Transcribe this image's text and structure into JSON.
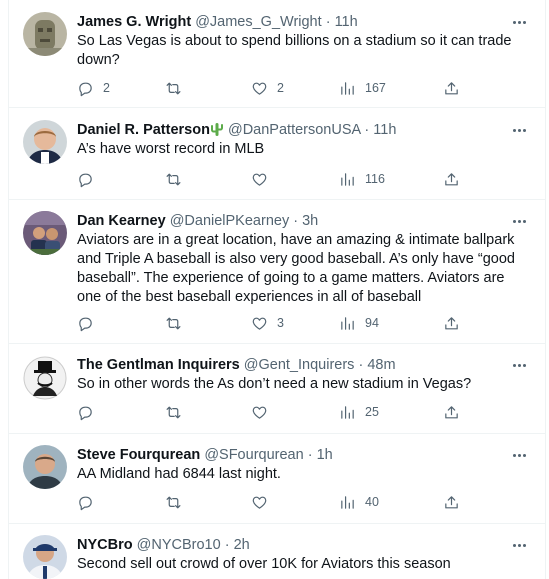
{
  "tweets": [
    {
      "name": "James G. Wright",
      "handle": "@James_G_Wright",
      "time": "11h",
      "text": "So Las Vegas is about to spend billions on a stadium so it can trade down?",
      "replies": "2",
      "retweets": "",
      "likes": "2",
      "views": "167"
    },
    {
      "name": "Daniel R. Patterson",
      "handle": "@DanPattersonUSA",
      "time": "11h",
      "text": "A’s have worst record in MLB",
      "replies": "",
      "retweets": "",
      "likes": "",
      "views": "116"
    },
    {
      "name": "Dan Kearney",
      "handle": "@DanielPKearney",
      "time": "3h",
      "text": "Aviators are in a great location, have an amazing & intimate ballpark and Triple A baseball is also very good baseball.  A’s only have “good baseball”.  The experience of going to a game matters.  Aviators are one of the best baseball experiences in all of baseball",
      "replies": "",
      "retweets": "",
      "likes": "3",
      "views": "94"
    },
    {
      "name": "The Gentlman Inquirers",
      "handle": "@Gent_Inquirers",
      "time": "48m",
      "text": "So in other words the As don’t need a new stadium in Vegas?",
      "replies": "",
      "retweets": "",
      "likes": "",
      "views": "25"
    },
    {
      "name": "Steve Fourqurean",
      "handle": "@SFourqurean",
      "time": "1h",
      "text": "AA Midland had 6844 last night.",
      "replies": "",
      "retweets": "",
      "likes": "",
      "views": "40"
    },
    {
      "name": "NYCBro",
      "handle": "@NYCBro10",
      "time": "2h",
      "text": "Second sell out crowd of over 10K for Aviators this season",
      "replies": "",
      "retweets": "",
      "likes": "",
      "views": ""
    }
  ],
  "icons": {
    "reply": "reply-icon",
    "retweet": "retweet-icon",
    "like": "heart-icon",
    "views": "views-icon",
    "share": "share-icon",
    "more": "more-icon",
    "badge": "cactus-icon"
  },
  "colors": {
    "text": "#0f1419",
    "secondary": "#536471",
    "divider": "#eff3f4",
    "badge": "#5cab4a"
  }
}
